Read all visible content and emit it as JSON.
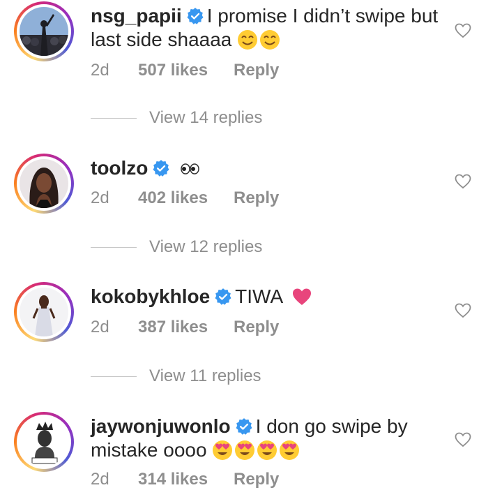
{
  "comments": [
    {
      "username": "nsg_papii",
      "verified": true,
      "text": "I promise I didn’t swipe but last side shaaaa",
      "emojis": [
        "smiling-face-icon",
        "smiling-face-icon"
      ],
      "age": "2d",
      "likes": "507 likes",
      "reply": "Reply",
      "view_replies": "View 14 replies"
    },
    {
      "username": "toolzo",
      "verified": true,
      "text": "",
      "emojis": [
        "eyes-icon"
      ],
      "age": "2d",
      "likes": "402 likes",
      "reply": "Reply",
      "view_replies": "View 12 replies"
    },
    {
      "username": "kokobykhloe",
      "verified": true,
      "text": "TIWA",
      "emojis": [
        "pink-heart-icon"
      ],
      "age": "2d",
      "likes": "387 likes",
      "reply": "Reply",
      "view_replies": "View 11 replies"
    },
    {
      "username": "jaywonjuwonlo",
      "verified": true,
      "text": "I don go swipe by mistake oooo",
      "emojis": [
        "heart-eyes-icon",
        "heart-eyes-icon",
        "heart-eyes-icon",
        "heart-eyes-icon"
      ],
      "age": "2d",
      "likes": "314 likes",
      "reply": "Reply"
    }
  ],
  "colors": {
    "verified": "#3897f0",
    "meta_text": "#8e8e8e",
    "emoji_face": "#ffcc33",
    "emoji_heart": "#e8457c"
  }
}
